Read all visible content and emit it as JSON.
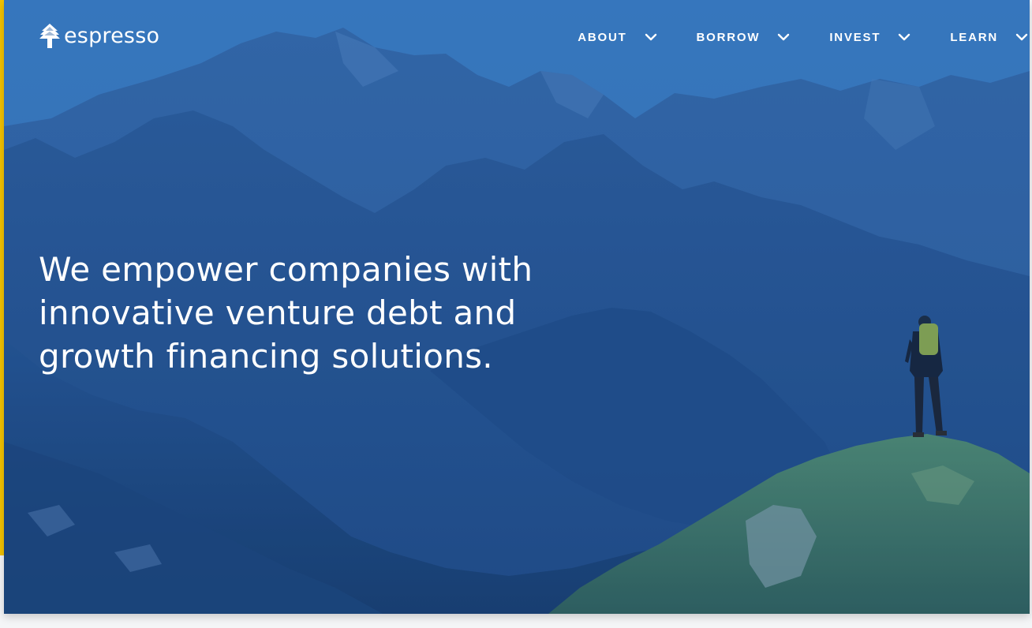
{
  "brand": {
    "name": "espresso",
    "logo_icon": "tree-icon"
  },
  "nav": {
    "items": [
      {
        "label": "ABOUT",
        "icon": "chevron-down-icon"
      },
      {
        "label": "BORROW",
        "icon": "chevron-down-icon"
      },
      {
        "label": "INVEST",
        "icon": "chevron-down-icon"
      },
      {
        "label": "LEARN",
        "icon": "chevron-down-icon"
      }
    ]
  },
  "hero": {
    "headline_lines": [
      "We empower companies with",
      "innovative venture debt and",
      "growth financing solutions."
    ],
    "background": "mountain-landscape-with-hiker"
  },
  "colors": {
    "accent": "#f2c200",
    "hero_tint": "#2f63a5",
    "text": "#ffffff"
  }
}
